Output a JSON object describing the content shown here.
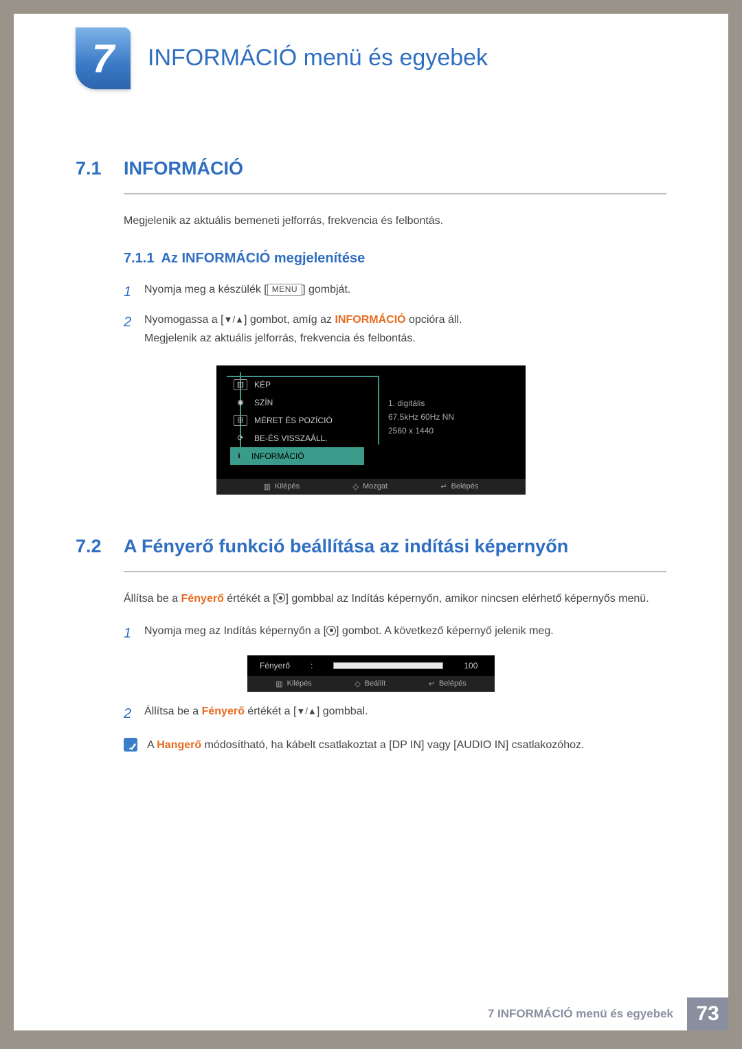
{
  "chapter": {
    "number": "7",
    "title": "INFORMÁCIÓ menü és egyebek"
  },
  "sec1": {
    "num": "7.1",
    "title": "INFORMÁCIÓ",
    "intro": "Megjelenik az aktuális bemeneti jelforrás, frekvencia és felbontás.",
    "sub": {
      "num": "7.1.1",
      "title": "Az INFORMÁCIÓ megjelenítése"
    },
    "steps": {
      "s1_a": "Nyomja meg a készülék [",
      "s1_menu": "MENU",
      "s1_b": "] gombját.",
      "s2_a": "Nyomogassa a [",
      "s2_arrows": "▼/▲",
      "s2_b": "] gombot, amíg az ",
      "s2_info": "INFORMÁCIÓ",
      "s2_c": " opcióra áll.",
      "s2_d": "Megjelenik az aktuális jelforrás, frekvencia és felbontás."
    }
  },
  "osd": {
    "items": [
      "KÉP",
      "SZÍN",
      "MÉRET ÉS POZÍCIÓ",
      "BE-ÉS VISSZAÁLL.",
      "INFORMÁCIÓ"
    ],
    "info_lines": [
      "1. digitális",
      "67.5kHz 60Hz NN",
      "2560 x 1440"
    ],
    "footer": {
      "exit": "Kilépés",
      "move": "Mozgat",
      "enter": "Belépés"
    }
  },
  "sec2": {
    "num": "7.2",
    "title": "A Fényerő funkció beállítása az indítási képernyőn",
    "intro_a": "Állítsa be a ",
    "intro_bright": "Fényerő",
    "intro_b": " értékét a [",
    "intro_c": "] gombbal az Indítás képernyőn, amikor nincsen elérhető képernyős menü.",
    "steps": {
      "s1_a": "Nyomja meg az Indítás képernyőn a [",
      "s1_b": "] gombot. A következő képernyő jelenik meg.",
      "s2_a": "Állítsa be a ",
      "s2_bright": "Fényerő",
      "s2_b": " értékét a [",
      "s2_arrows": "▼/▲",
      "s2_c": "] gombbal."
    }
  },
  "brightness": {
    "label": "Fényerő",
    "separator": ":",
    "value": "100",
    "footer": {
      "exit": "Kilépés",
      "adjust": "Beállít",
      "enter": "Belépés"
    }
  },
  "note": {
    "a": "A ",
    "hangero": "Hangerő",
    "b": " módosítható, ha kábelt csatlakoztat a [DP IN] vagy [AUDIO IN] csatlakozóhoz."
  },
  "footer": {
    "text": "7 INFORMÁCIÓ menü és egyebek",
    "page": "73"
  },
  "step_numbers": {
    "one": "1",
    "two": "2"
  }
}
